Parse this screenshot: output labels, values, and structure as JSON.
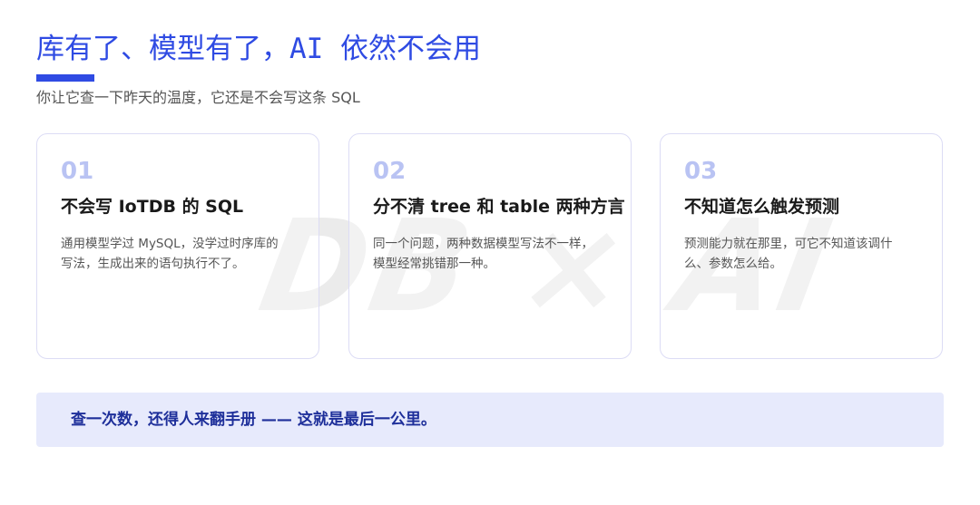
{
  "header": {
    "title": "库有了、模型有了，AI 依然不会用",
    "subtitle": "你让它查一下昨天的温度，它还是不会写这条 SQL"
  },
  "watermark": "DB × AI",
  "cards": [
    {
      "number": "01",
      "heading": "不会写 IoTDB 的 SQL",
      "lines": [
        "通用模型学过 MySQL，没学过时序库的",
        "写法，生成出来的语句执行不了。"
      ]
    },
    {
      "number": "02",
      "heading": "分不清 tree 和 table 两种方言",
      "lines": [
        "同一个问题，两种数据模型写法不一样，",
        "模型经常挑错那一种。"
      ]
    },
    {
      "number": "03",
      "heading": "不知道怎么触发预测",
      "lines": [
        "预测能力就在那里，可它不知道该调什",
        "么、参数怎么给。"
      ]
    }
  ],
  "footer": {
    "text": "查一次数，还得人来翻手册 —— 这就是最后一公里。"
  },
  "colors": {
    "accent": "#2f4be3",
    "number": "#b9c3f3",
    "footer_bg": "#e7eafc",
    "footer_text": "#1e2f9a"
  }
}
